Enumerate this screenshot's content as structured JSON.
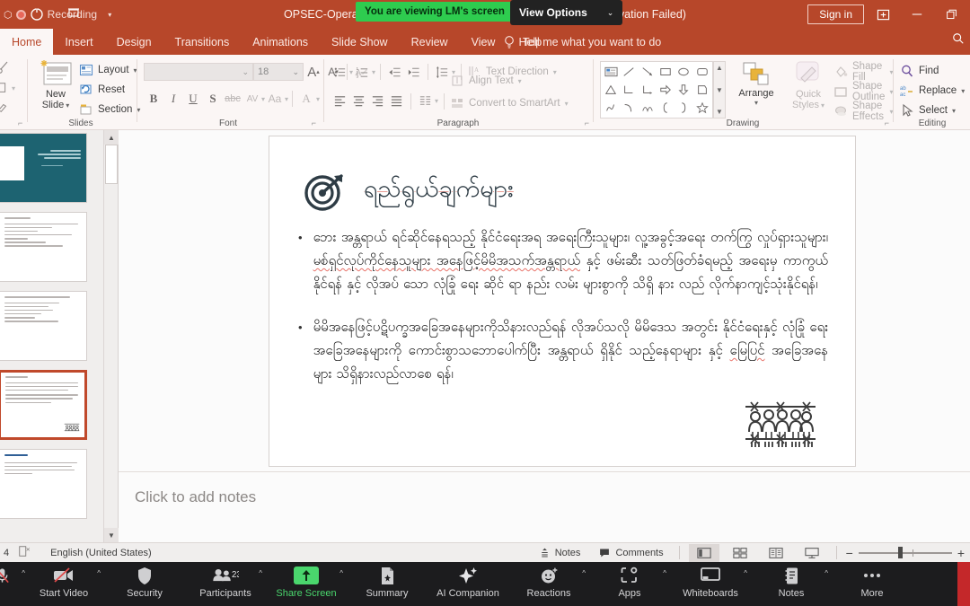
{
  "titlebar": {
    "recording_label": "Recording",
    "recording_icon": "record-dot-icon",
    "document_title": "OPSEC-Operatio",
    "document_title_right": "(Activation Failed)",
    "viewing_badge": "You are viewing LM's screen",
    "view_options": "View Options",
    "view_options_caret": "⌄",
    "signin": "Sign in",
    "present_icon": "present-online-icon",
    "minimize_icon": "minimize-icon",
    "restore_icon": "restore-icon"
  },
  "ribbon": {
    "tabs": [
      {
        "label": "Home",
        "active": true
      },
      {
        "label": "Insert",
        "active": false
      },
      {
        "label": "Design",
        "active": false
      },
      {
        "label": "Transitions",
        "active": false
      },
      {
        "label": "Animations",
        "active": false
      },
      {
        "label": "Slide Show",
        "active": false
      },
      {
        "label": "Review",
        "active": false
      },
      {
        "label": "View",
        "active": false
      },
      {
        "label": "Help",
        "active": false
      }
    ],
    "tellme": "Tell me what you want to do",
    "groups": {
      "clipboard": {
        "label": ""
      },
      "slides": {
        "label": "Slides",
        "new_slide": "New\nSlide",
        "new_slide_line1": "New",
        "new_slide_line2": "Slide",
        "layout": "Layout",
        "reset": "Reset",
        "section": "Section"
      },
      "font": {
        "label": "Font",
        "font_name": "",
        "font_size": "18",
        "grow": "A",
        "shrink": "A",
        "clear_format": "clear-formatting-icon",
        "bold": "B",
        "italic": "I",
        "underline": "U",
        "shadow": "S",
        "strikethrough": "abc",
        "spacing": "AV",
        "change_case": "Aa",
        "font_color": "A"
      },
      "paragraph": {
        "label": "Paragraph",
        "text_direction": "Text Direction",
        "align_text": "Align Text",
        "convert_smartart": "Convert to SmartArt"
      },
      "drawing": {
        "label": "Drawing",
        "arrange": "Arrange",
        "quick_styles_l1": "Quick",
        "quick_styles_l2": "Styles",
        "shape_fill": "Shape Fill",
        "shape_outline": "Shape Outline",
        "shape_effects": "Shape Effects"
      },
      "editing": {
        "label": "Editing",
        "find": "Find",
        "replace": "Replace",
        "select": "Select"
      }
    }
  },
  "thumbnails": {
    "selected_index": 3,
    "items": [
      {
        "kind": "title-slide"
      },
      {
        "kind": "text-slide"
      },
      {
        "kind": "text-slide"
      },
      {
        "kind": "text-slide-fence"
      },
      {
        "kind": "text-slide-blue"
      }
    ]
  },
  "slide": {
    "title": "ရည်ရွယ်ချက်များ",
    "title_icon": "target-dartboard-icon",
    "bullet_char": "•",
    "bullets": [
      {
        "segments": [
          {
            "text": "ဘေး အန္တရာယ် ရင်ဆိုင်နေရသည့် နိုင်ငံရေးအရ အရေးကြီးသူများ၊ လူ့အခွင့်အရေး တက်ကြွ လှုပ်ရှားသူများ၊ ",
            "spell": false
          },
          {
            "text": "မစ်ရှင်လုပ်ကိုင်နေသူများ အနေဖြင့်မိမိအသက်အန္တရာယ်",
            "spell": true
          },
          {
            "text": " နှင့် ဖမ်းဆီး သတ်ဖြတ်ခံရမည့် အရေးမှ ကာကွယ်နိုင်ရန် နှင့် လိုအပ် သော လုံခြုံ ရေး ဆိုင် ရာ နည်း လမ်း များစွာကို သိရှိ နား လည် လိုက်နာကျင့်သုံးနိုင်ရန်၊",
            "spell": false
          }
        ]
      },
      {
        "segments": [
          {
            "text": "မိမိအနေဖြင့်ပဋိပက္ခအခြေအနေများကိုသိနားလည်ရန် လိုအပ်သလို မိမိဒေသ အတွင်း နိုင်ငံရေးနှင့် လုံခြုံ ရေး အခြေအနေများကို ကောင်းစွာသဘောပေါက်ပြီး အန္တရာယ် ရှိနိုင် သည့်နေရာများ နှင့် ",
            "spell": false
          },
          {
            "text": "မြေပြင်",
            "spell": true
          },
          {
            "text": " အခြေအနေများ သိရှိနားလည်လာစေ ရန်၊",
            "spell": false
          }
        ]
      }
    ],
    "artwork": "people-behind-barbed-wire-fence-icon"
  },
  "notes": {
    "placeholder": "Click to add notes"
  },
  "statusbar": {
    "slide_number": "4",
    "accessibility_icon": "accessibility-icon",
    "language": "English (United States)",
    "notes": "Notes",
    "comments": "Comments",
    "view_normal": "normal-view-icon",
    "view_sorter": "slide-sorter-icon",
    "view_reading": "reading-view-icon",
    "view_slideshow": "slideshow-view-icon",
    "zoom_out": "−",
    "zoom_in": "+"
  },
  "zoombar": {
    "items": [
      {
        "name": "mute",
        "label": "",
        "icon": "microphone-muted-icon",
        "caret": true,
        "active": false,
        "badge": ""
      },
      {
        "name": "start-video",
        "label": "Start Video",
        "icon": "video-off-icon",
        "caret": true,
        "active": false,
        "badge": ""
      },
      {
        "name": "security",
        "label": "Security",
        "icon": "shield-icon",
        "caret": false,
        "active": false,
        "badge": ""
      },
      {
        "name": "participants",
        "label": "Participants",
        "icon": "people-icon",
        "caret": true,
        "active": false,
        "badge": "23"
      },
      {
        "name": "share-screen",
        "label": "Share Screen",
        "icon": "share-screen-up-arrow-icon",
        "caret": true,
        "active": true,
        "badge": ""
      },
      {
        "name": "summary",
        "label": "Summary",
        "icon": "summary-doc-icon",
        "caret": false,
        "active": false,
        "badge": ""
      },
      {
        "name": "ai-companion",
        "label": "AI Companion",
        "icon": "sparkle-icon",
        "caret": false,
        "active": false,
        "badge": ""
      },
      {
        "name": "reactions",
        "label": "Reactions",
        "icon": "smiley-reaction-icon",
        "caret": true,
        "active": false,
        "badge": ""
      },
      {
        "name": "apps",
        "label": "Apps",
        "icon": "apps-icon",
        "caret": true,
        "active": false,
        "badge": ""
      },
      {
        "name": "whiteboards",
        "label": "Whiteboards",
        "icon": "whiteboard-icon",
        "caret": true,
        "active": false,
        "badge": ""
      },
      {
        "name": "notes",
        "label": "Notes",
        "icon": "notes-icon",
        "caret": true,
        "active": false,
        "badge": ""
      },
      {
        "name": "more",
        "label": "More",
        "icon": "ellipsis-icon",
        "caret": false,
        "active": false,
        "badge": ""
      }
    ]
  },
  "colors": {
    "powerpoint_orange": "#b7472a",
    "zoom_green": "#2ecc4f",
    "selection_orange": "#c0492b",
    "slide_teal": "#1d6371",
    "spellcheck_red": "#e8736a"
  }
}
